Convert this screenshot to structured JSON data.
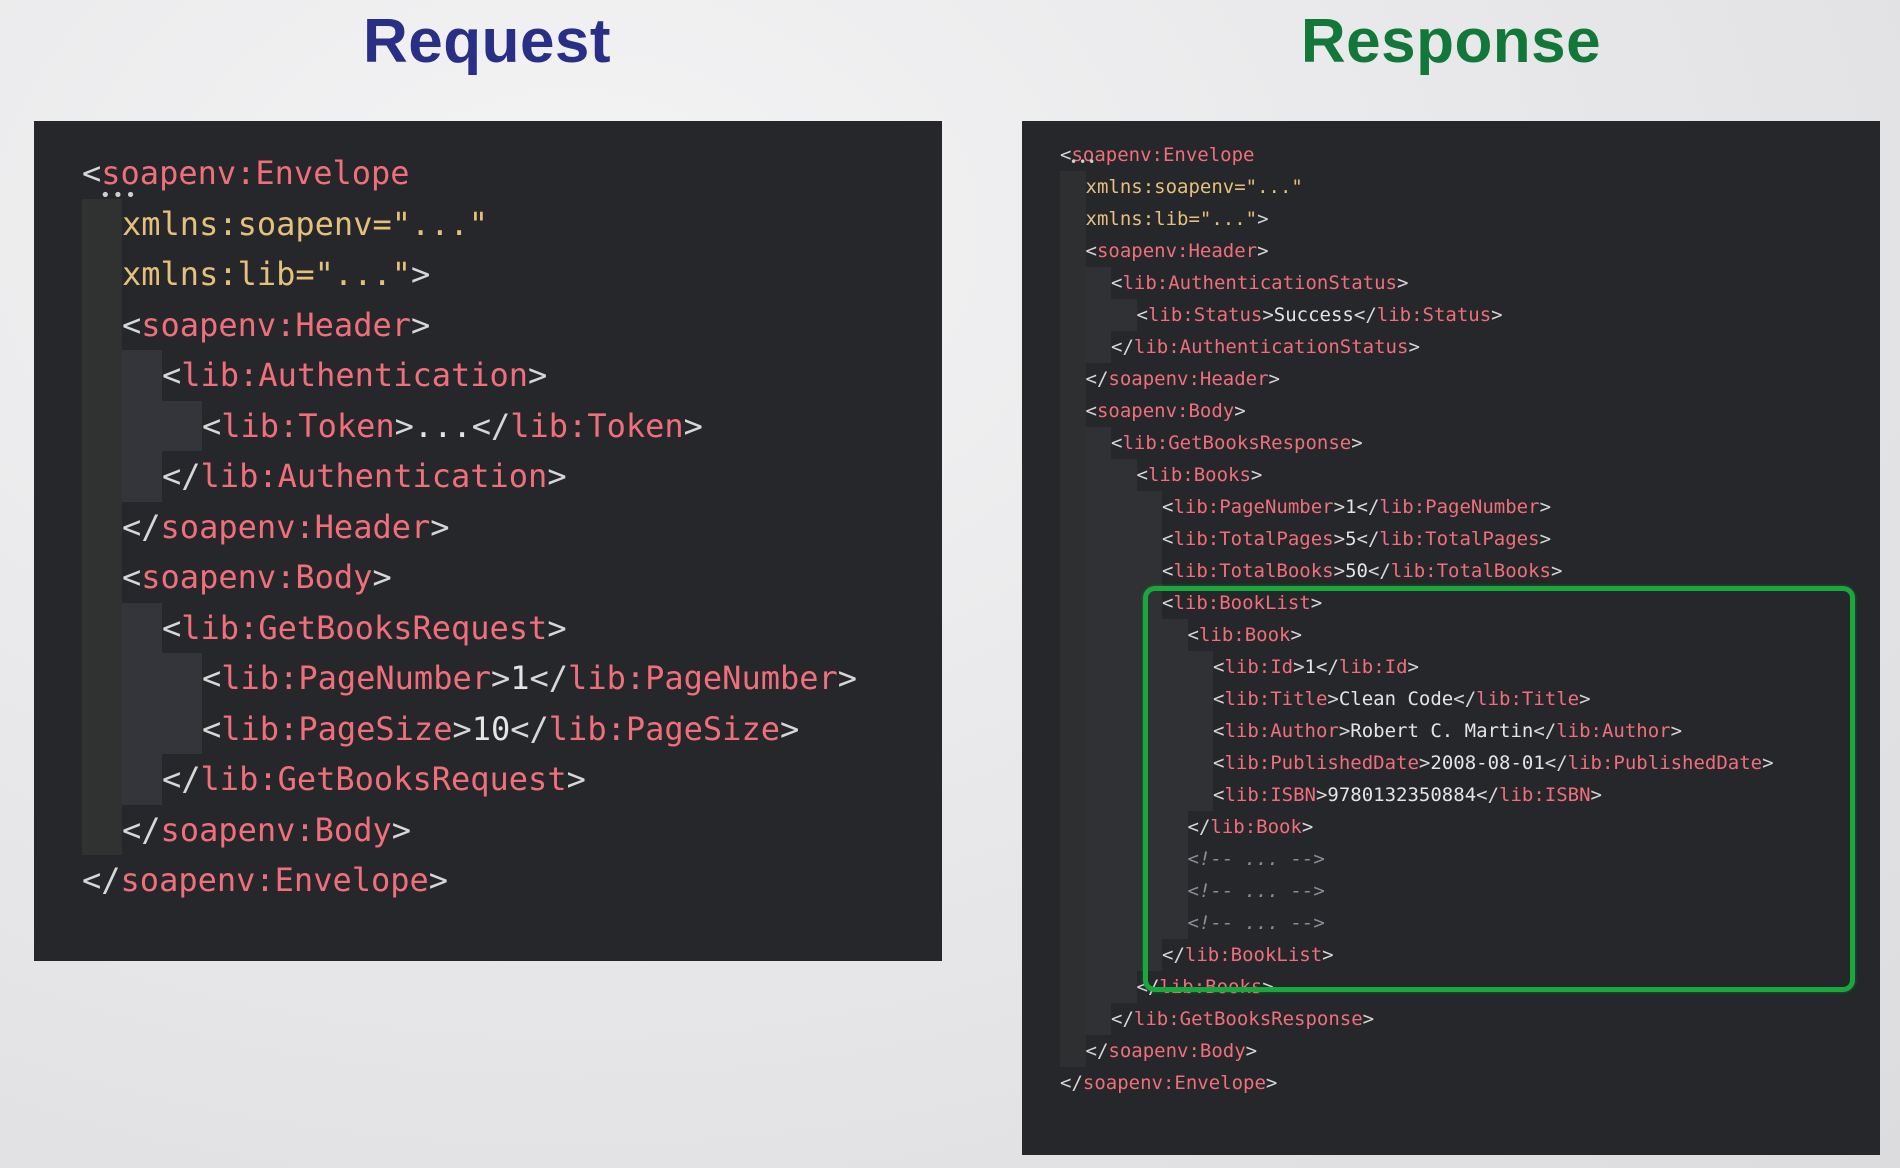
{
  "request": {
    "heading": "Request",
    "heading_color": "#2a2f86",
    "lines": [
      [
        [
          {
            "c": "p",
            "v": "<"
          },
          {
            "c": "t",
            "v": "soapenv:Envelope"
          }
        ],
        0,
        true
      ],
      [
        [
          {
            "c": "a",
            "v": "xmlns:soapenv=\"...\""
          }
        ],
        1
      ],
      [
        [
          {
            "c": "a",
            "v": "xmlns:lib=\"...\""
          },
          {
            "c": "p",
            "v": ">"
          }
        ],
        1
      ],
      [
        [
          {
            "c": "p",
            "v": "<"
          },
          {
            "c": "t",
            "v": "soapenv:Header"
          },
          {
            "c": "p",
            "v": ">"
          }
        ],
        1
      ],
      [
        [
          {
            "c": "p",
            "v": "<"
          },
          {
            "c": "t",
            "v": "lib:Authentication"
          },
          {
            "c": "p",
            "v": ">"
          }
        ],
        2
      ],
      [
        [
          {
            "c": "p",
            "v": "<"
          },
          {
            "c": "t",
            "v": "lib:Token"
          },
          {
            "c": "p",
            "v": ">"
          },
          {
            "c": "tx",
            "v": "..."
          },
          {
            "c": "p",
            "v": "</"
          },
          {
            "c": "t",
            "v": "lib:Token"
          },
          {
            "c": "p",
            "v": ">"
          }
        ],
        3
      ],
      [
        [
          {
            "c": "p",
            "v": "</"
          },
          {
            "c": "t",
            "v": "lib:Authentication"
          },
          {
            "c": "p",
            "v": ">"
          }
        ],
        2
      ],
      [
        [
          {
            "c": "p",
            "v": "</"
          },
          {
            "c": "t",
            "v": "soapenv:Header"
          },
          {
            "c": "p",
            "v": ">"
          }
        ],
        1
      ],
      [
        [
          {
            "c": "p",
            "v": "<"
          },
          {
            "c": "t",
            "v": "soapenv:Body"
          },
          {
            "c": "p",
            "v": ">"
          }
        ],
        1
      ],
      [
        [
          {
            "c": "p",
            "v": "<"
          },
          {
            "c": "t",
            "v": "lib:GetBooksRequest"
          },
          {
            "c": "p",
            "v": ">"
          }
        ],
        2
      ],
      [
        [
          {
            "c": "p",
            "v": "<"
          },
          {
            "c": "t",
            "v": "lib:PageNumber"
          },
          {
            "c": "p",
            "v": ">"
          },
          {
            "c": "tx",
            "v": "1"
          },
          {
            "c": "p",
            "v": "</"
          },
          {
            "c": "t",
            "v": "lib:PageNumber"
          },
          {
            "c": "p",
            "v": ">"
          }
        ],
        3
      ],
      [
        [
          {
            "c": "p",
            "v": "<"
          },
          {
            "c": "t",
            "v": "lib:PageSize"
          },
          {
            "c": "p",
            "v": ">"
          },
          {
            "c": "tx",
            "v": "10"
          },
          {
            "c": "p",
            "v": "</"
          },
          {
            "c": "t",
            "v": "lib:PageSize"
          },
          {
            "c": "p",
            "v": ">"
          }
        ],
        3
      ],
      [
        [
          {
            "c": "p",
            "v": "</"
          },
          {
            "c": "t",
            "v": "lib:GetBooksRequest"
          },
          {
            "c": "p",
            "v": ">"
          }
        ],
        2
      ],
      [
        [
          {
            "c": "p",
            "v": "</"
          },
          {
            "c": "t",
            "v": "soapenv:Body"
          },
          {
            "c": "p",
            "v": ">"
          }
        ],
        1
      ],
      [
        [
          {
            "c": "p",
            "v": "</"
          },
          {
            "c": "t",
            "v": "soapenv:Envelope"
          },
          {
            "c": "p",
            "v": ">"
          }
        ],
        0
      ]
    ]
  },
  "response": {
    "heading": "Response",
    "heading_color": "#12783a",
    "highlight_color": "#19a83c",
    "lines": [
      [
        [
          {
            "c": "p",
            "v": "<"
          },
          {
            "c": "t",
            "v": "soapenv:Envelope"
          }
        ],
        0,
        true
      ],
      [
        [
          {
            "c": "a",
            "v": "xmlns:soapenv=\"...\""
          }
        ],
        1
      ],
      [
        [
          {
            "c": "a",
            "v": "xmlns:lib=\"...\""
          },
          {
            "c": "p",
            "v": ">"
          }
        ],
        1
      ],
      [
        [
          {
            "c": "p",
            "v": "<"
          },
          {
            "c": "t",
            "v": "soapenv:Header"
          },
          {
            "c": "p",
            "v": ">"
          }
        ],
        1
      ],
      [
        [
          {
            "c": "p",
            "v": "<"
          },
          {
            "c": "t",
            "v": "lib:AuthenticationStatus"
          },
          {
            "c": "p",
            "v": ">"
          }
        ],
        2
      ],
      [
        [
          {
            "c": "p",
            "v": "<"
          },
          {
            "c": "t",
            "v": "lib:Status"
          },
          {
            "c": "p",
            "v": ">"
          },
          {
            "c": "tx",
            "v": "Success"
          },
          {
            "c": "p",
            "v": "</"
          },
          {
            "c": "t",
            "v": "lib:Status"
          },
          {
            "c": "p",
            "v": ">"
          }
        ],
        3
      ],
      [
        [
          {
            "c": "p",
            "v": "</"
          },
          {
            "c": "t",
            "v": "lib:AuthenticationStatus"
          },
          {
            "c": "p",
            "v": ">"
          }
        ],
        2
      ],
      [
        [
          {
            "c": "p",
            "v": "</"
          },
          {
            "c": "t",
            "v": "soapenv:Header"
          },
          {
            "c": "p",
            "v": ">"
          }
        ],
        1
      ],
      [
        [
          {
            "c": "p",
            "v": "<"
          },
          {
            "c": "t",
            "v": "soapenv:Body"
          },
          {
            "c": "p",
            "v": ">"
          }
        ],
        1
      ],
      [
        [
          {
            "c": "p",
            "v": "<"
          },
          {
            "c": "t",
            "v": "lib:GetBooksResponse"
          },
          {
            "c": "p",
            "v": ">"
          }
        ],
        2
      ],
      [
        [
          {
            "c": "p",
            "v": "<"
          },
          {
            "c": "t",
            "v": "lib:Books"
          },
          {
            "c": "p",
            "v": ">"
          }
        ],
        3
      ],
      [
        [
          {
            "c": "p",
            "v": "<"
          },
          {
            "c": "t",
            "v": "lib:PageNumber"
          },
          {
            "c": "p",
            "v": ">"
          },
          {
            "c": "tx",
            "v": "1"
          },
          {
            "c": "p",
            "v": "</"
          },
          {
            "c": "t",
            "v": "lib:PageNumber"
          },
          {
            "c": "p",
            "v": ">"
          }
        ],
        4
      ],
      [
        [
          {
            "c": "p",
            "v": "<"
          },
          {
            "c": "t",
            "v": "lib:TotalPages"
          },
          {
            "c": "p",
            "v": ">"
          },
          {
            "c": "tx",
            "v": "5"
          },
          {
            "c": "p",
            "v": "</"
          },
          {
            "c": "t",
            "v": "lib:TotalPages"
          },
          {
            "c": "p",
            "v": ">"
          }
        ],
        4
      ],
      [
        [
          {
            "c": "p",
            "v": "<"
          },
          {
            "c": "t",
            "v": "lib:TotalBooks"
          },
          {
            "c": "p",
            "v": ">"
          },
          {
            "c": "tx",
            "v": "50"
          },
          {
            "c": "p",
            "v": "</"
          },
          {
            "c": "t",
            "v": "lib:TotalBooks"
          },
          {
            "c": "p",
            "v": ">"
          }
        ],
        4
      ],
      [
        [
          {
            "c": "p",
            "v": "<"
          },
          {
            "c": "t",
            "v": "lib:BookList"
          },
          {
            "c": "p",
            "v": ">"
          }
        ],
        4
      ],
      [
        [
          {
            "c": "p",
            "v": "<"
          },
          {
            "c": "t",
            "v": "lib:Book"
          },
          {
            "c": "p",
            "v": ">"
          }
        ],
        5
      ],
      [
        [
          {
            "c": "p",
            "v": "<"
          },
          {
            "c": "t",
            "v": "lib:Id"
          },
          {
            "c": "p",
            "v": ">"
          },
          {
            "c": "tx",
            "v": "1"
          },
          {
            "c": "p",
            "v": "</"
          },
          {
            "c": "t",
            "v": "lib:Id"
          },
          {
            "c": "p",
            "v": ">"
          }
        ],
        6
      ],
      [
        [
          {
            "c": "p",
            "v": "<"
          },
          {
            "c": "t",
            "v": "lib:Title"
          },
          {
            "c": "p",
            "v": ">"
          },
          {
            "c": "tx",
            "v": "Clean Code"
          },
          {
            "c": "p",
            "v": "</"
          },
          {
            "c": "t",
            "v": "lib:Title"
          },
          {
            "c": "p",
            "v": ">"
          }
        ],
        6
      ],
      [
        [
          {
            "c": "p",
            "v": "<"
          },
          {
            "c": "t",
            "v": "lib:Author"
          },
          {
            "c": "p",
            "v": ">"
          },
          {
            "c": "tx",
            "v": "Robert C. Martin"
          },
          {
            "c": "p",
            "v": "</"
          },
          {
            "c": "t",
            "v": "lib:Author"
          },
          {
            "c": "p",
            "v": ">"
          }
        ],
        6
      ],
      [
        [
          {
            "c": "p",
            "v": "<"
          },
          {
            "c": "t",
            "v": "lib:PublishedDate"
          },
          {
            "c": "p",
            "v": ">"
          },
          {
            "c": "tx",
            "v": "2008-08-01"
          },
          {
            "c": "p",
            "v": "</"
          },
          {
            "c": "t",
            "v": "lib:PublishedDate"
          },
          {
            "c": "p",
            "v": ">"
          }
        ],
        6
      ],
      [
        [
          {
            "c": "p",
            "v": "<"
          },
          {
            "c": "t",
            "v": "lib:ISBN"
          },
          {
            "c": "p",
            "v": ">"
          },
          {
            "c": "tx",
            "v": "9780132350884"
          },
          {
            "c": "p",
            "v": "</"
          },
          {
            "c": "t",
            "v": "lib:ISBN"
          },
          {
            "c": "p",
            "v": ">"
          }
        ],
        6
      ],
      [
        [
          {
            "c": "p",
            "v": "</"
          },
          {
            "c": "t",
            "v": "lib:Book"
          },
          {
            "c": "p",
            "v": ">"
          }
        ],
        5
      ],
      [
        [
          {
            "c": "c",
            "v": "<!-- ... -->"
          }
        ],
        5
      ],
      [
        [
          {
            "c": "c",
            "v": "<!-- ... -->"
          }
        ],
        5
      ],
      [
        [
          {
            "c": "c",
            "v": "<!-- ... -->"
          }
        ],
        5
      ],
      [
        [
          {
            "c": "p",
            "v": "</"
          },
          {
            "c": "t",
            "v": "lib:BookList"
          },
          {
            "c": "p",
            "v": ">"
          }
        ],
        4
      ],
      [
        [
          {
            "c": "p",
            "v": "</"
          },
          {
            "c": "t",
            "v": "lib:Books"
          },
          {
            "c": "p",
            "v": ">"
          }
        ],
        3
      ],
      [
        [
          {
            "c": "p",
            "v": "</"
          },
          {
            "c": "t",
            "v": "lib:GetBooksResponse"
          },
          {
            "c": "p",
            "v": ">"
          }
        ],
        2
      ],
      [
        [
          {
            "c": "p",
            "v": "</"
          },
          {
            "c": "t",
            "v": "soapenv:Body"
          },
          {
            "c": "p",
            "v": ">"
          }
        ],
        1
      ],
      [
        [
          {
            "c": "p",
            "v": "</"
          },
          {
            "c": "t",
            "v": "soapenv:Envelope"
          },
          {
            "c": "p",
            "v": ">"
          }
        ],
        0
      ]
    ]
  }
}
